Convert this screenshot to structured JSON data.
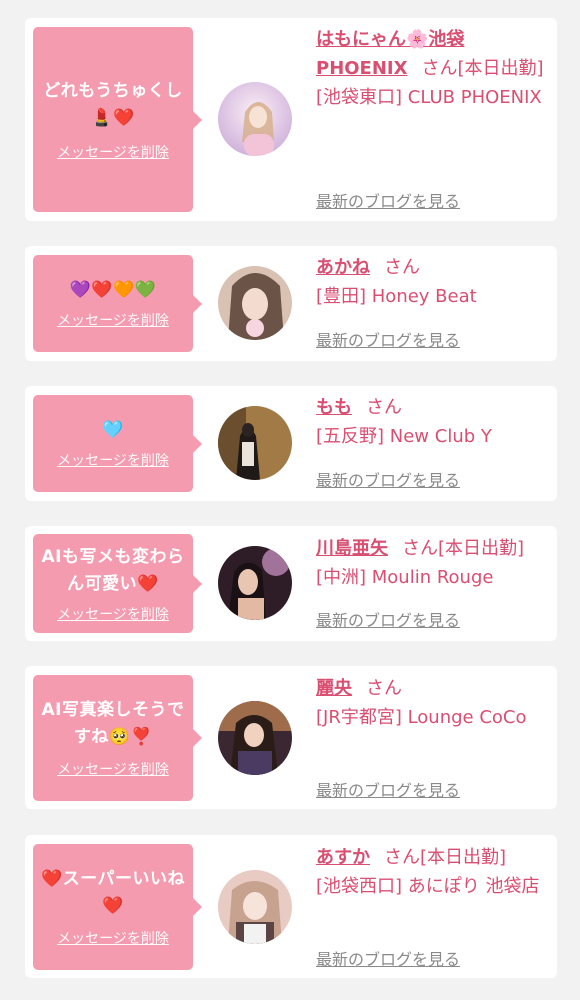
{
  "cards": [
    {
      "message": "どれもうちゅくし💄❤️",
      "delete_label": "メッセージを削除",
      "name": "はもにゃん🌸池袋PHOENIX",
      "suffix": "さん[本日出勤]",
      "store": "[池袋東口] CLUB PHOENIX",
      "blog_label": "最新のブログを見る",
      "avatar_colors": [
        "#f3d7ea",
        "#c9a9d8"
      ]
    },
    {
      "message": "💜❤️🧡💚",
      "delete_label": "メッセージを削除",
      "name": "あかね",
      "suffix": "さん",
      "store": "[豊田] Honey Beat",
      "blog_label": "最新のブログを見る",
      "avatar_colors": [
        "#d9c2b4",
        "#6c5347"
      ]
    },
    {
      "message": "🩵",
      "delete_label": "メッセージを削除",
      "name": "もも",
      "suffix": "さん",
      "store": "[五反野] New Club Y",
      "blog_label": "最新のブログを見る",
      "avatar_colors": [
        "#a27a45",
        "#3c2b1d"
      ]
    },
    {
      "message": "AIも写メも変わらん可愛い❤️",
      "delete_label": "メッセージを削除",
      "name": "川島亜矢",
      "suffix": "さん[本日出勤]",
      "store": "[中洲] Moulin Rouge",
      "blog_label": "最新のブログを見る",
      "avatar_colors": [
        "#bf8ab8",
        "#2e1d27"
      ]
    },
    {
      "message": "AI写真楽しそうですね🥺❣️",
      "delete_label": "メッセージを削除",
      "name": "麗央",
      "suffix": "さん",
      "store": "[JR宇都宮] Lounge CoCo",
      "blog_label": "最新のブログを見る",
      "avatar_colors": [
        "#c98a55",
        "#3a2732"
      ]
    },
    {
      "message": "❤️スーパーいいね❤️",
      "delete_label": "メッセージを削除",
      "name": "あすか",
      "suffix": "さん[本日出勤]",
      "store": "[池袋西口] あにぽり 池袋店",
      "blog_label": "最新のブログを見る",
      "avatar_colors": [
        "#e8ccc3",
        "#5a4444"
      ]
    }
  ]
}
